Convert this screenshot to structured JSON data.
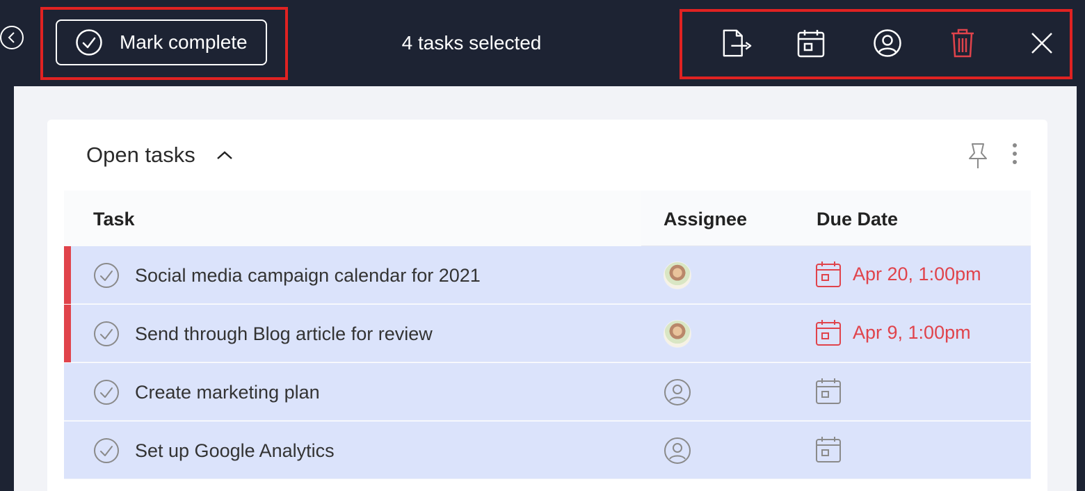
{
  "toolbar": {
    "mark_complete_label": "Mark complete",
    "selection_count": "4 tasks selected",
    "icons": [
      "move-task-icon",
      "calendar-icon",
      "assignee-icon",
      "trash-icon",
      "close-icon"
    ],
    "delete_color": "#e0434b"
  },
  "section": {
    "title": "Open tasks"
  },
  "table": {
    "headers": {
      "task": "Task",
      "assignee": "Assignee",
      "due": "Due Date"
    },
    "rows": [
      {
        "task": "Social media campaign calendar for 2021",
        "assignee": "avatar",
        "due": "Apr 20, 1:00pm",
        "overdue": true
      },
      {
        "task": "Send through Blog article for review",
        "assignee": "avatar",
        "due": "Apr 9, 1:00pm",
        "overdue": true
      },
      {
        "task": "Create marketing plan",
        "assignee": "unassigned",
        "due": "",
        "overdue": false
      },
      {
        "task": "Set up Google Analytics",
        "assignee": "unassigned",
        "due": "",
        "overdue": false
      }
    ]
  },
  "colors": {
    "topbar": "#1d2333",
    "selected_row": "#dbe3fb",
    "overdue": "#e0434b",
    "highlight_box": "#e02222"
  }
}
